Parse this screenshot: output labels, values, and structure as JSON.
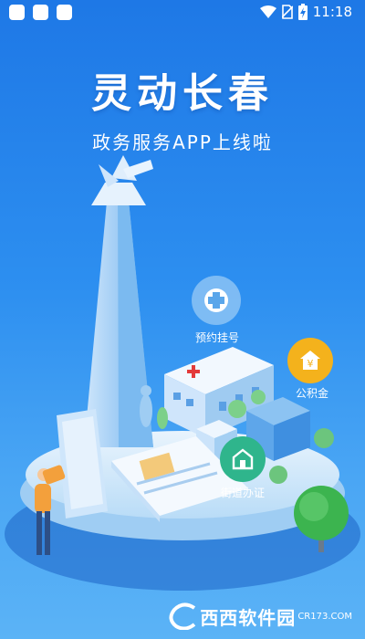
{
  "status_bar": {
    "time": "11:18",
    "icons": [
      "notification-square-icon",
      "notification-square-icon",
      "notification-square-icon",
      "wifi-icon",
      "no-sim-icon",
      "battery-charging-icon"
    ]
  },
  "splash": {
    "title": "灵动长春",
    "subtitle": "政务服务APP上线啦"
  },
  "features": [
    {
      "label": "预约挂号",
      "icon": "hospital-cross-icon",
      "color": "#5aa6ea"
    },
    {
      "label": "公积金",
      "icon": "house-yen-icon",
      "color": "#f4b21c"
    },
    {
      "label": "街道办证",
      "icon": "building-icon",
      "color": "#2fb58c"
    }
  ],
  "watermark": {
    "brand": "西西软件园",
    "url": "CR173.COM"
  },
  "colors": {
    "background_top": "#1e78e6",
    "background_bottom": "#5bb3f6",
    "hospital_bubble": "#5aa6ea",
    "fund_bubble": "#f4b21c",
    "office_bubble": "#2fb58c"
  }
}
